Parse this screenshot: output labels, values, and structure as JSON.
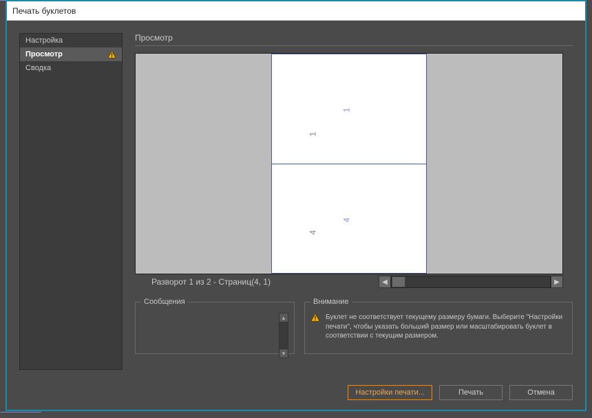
{
  "window": {
    "title": "Печать буклетов"
  },
  "sidebar": {
    "items": [
      {
        "label": "Настройка",
        "selected": false,
        "warning": false
      },
      {
        "label": "Просмотр",
        "selected": true,
        "warning": true
      },
      {
        "label": "Сводка",
        "selected": false,
        "warning": false
      }
    ]
  },
  "main": {
    "preview_title": "Просмотр",
    "pager_label": "Разворот 1 из 2 - Страниц(4, 1)",
    "spread_pages": [
      {
        "blue_num": "1",
        "gray_num": "1"
      },
      {
        "blue_num": "4",
        "gray_num": "4"
      }
    ]
  },
  "messages": {
    "legend": "Сообщения"
  },
  "warning": {
    "legend": "Внимание",
    "text": "Буклет не соответствует текущему размеру бумаги. Выберите \"Настройки печати\", чтобы указать больший размер или масштабировать буклет в соответствии с текущим размером."
  },
  "footer": {
    "print_settings": "Настройки печати...",
    "print": "Печать",
    "cancel": "Отмена"
  }
}
